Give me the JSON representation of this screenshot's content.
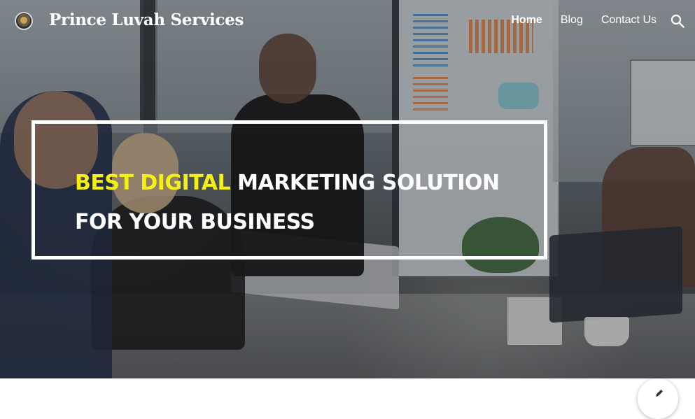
{
  "site": {
    "title": "Prince Luvah Services",
    "logo_icon": "site-logo-emblem"
  },
  "nav": {
    "items": [
      {
        "label": "Home",
        "active": true
      },
      {
        "label": "Blog",
        "active": false
      },
      {
        "label": "Contact Us",
        "active": false
      }
    ],
    "search_icon": "search-icon"
  },
  "hero": {
    "headline_accent": "BEST DIGITAL",
    "headline_rest": " MARKETING SOLUTION",
    "headline_line2": "FOR YOUR BUSINESS",
    "accent_color": "#f5ef16",
    "text_color": "#ffffff",
    "background_description_icon": "office-meeting-photo"
  },
  "fab": {
    "icon": "edit-pencil-icon"
  }
}
